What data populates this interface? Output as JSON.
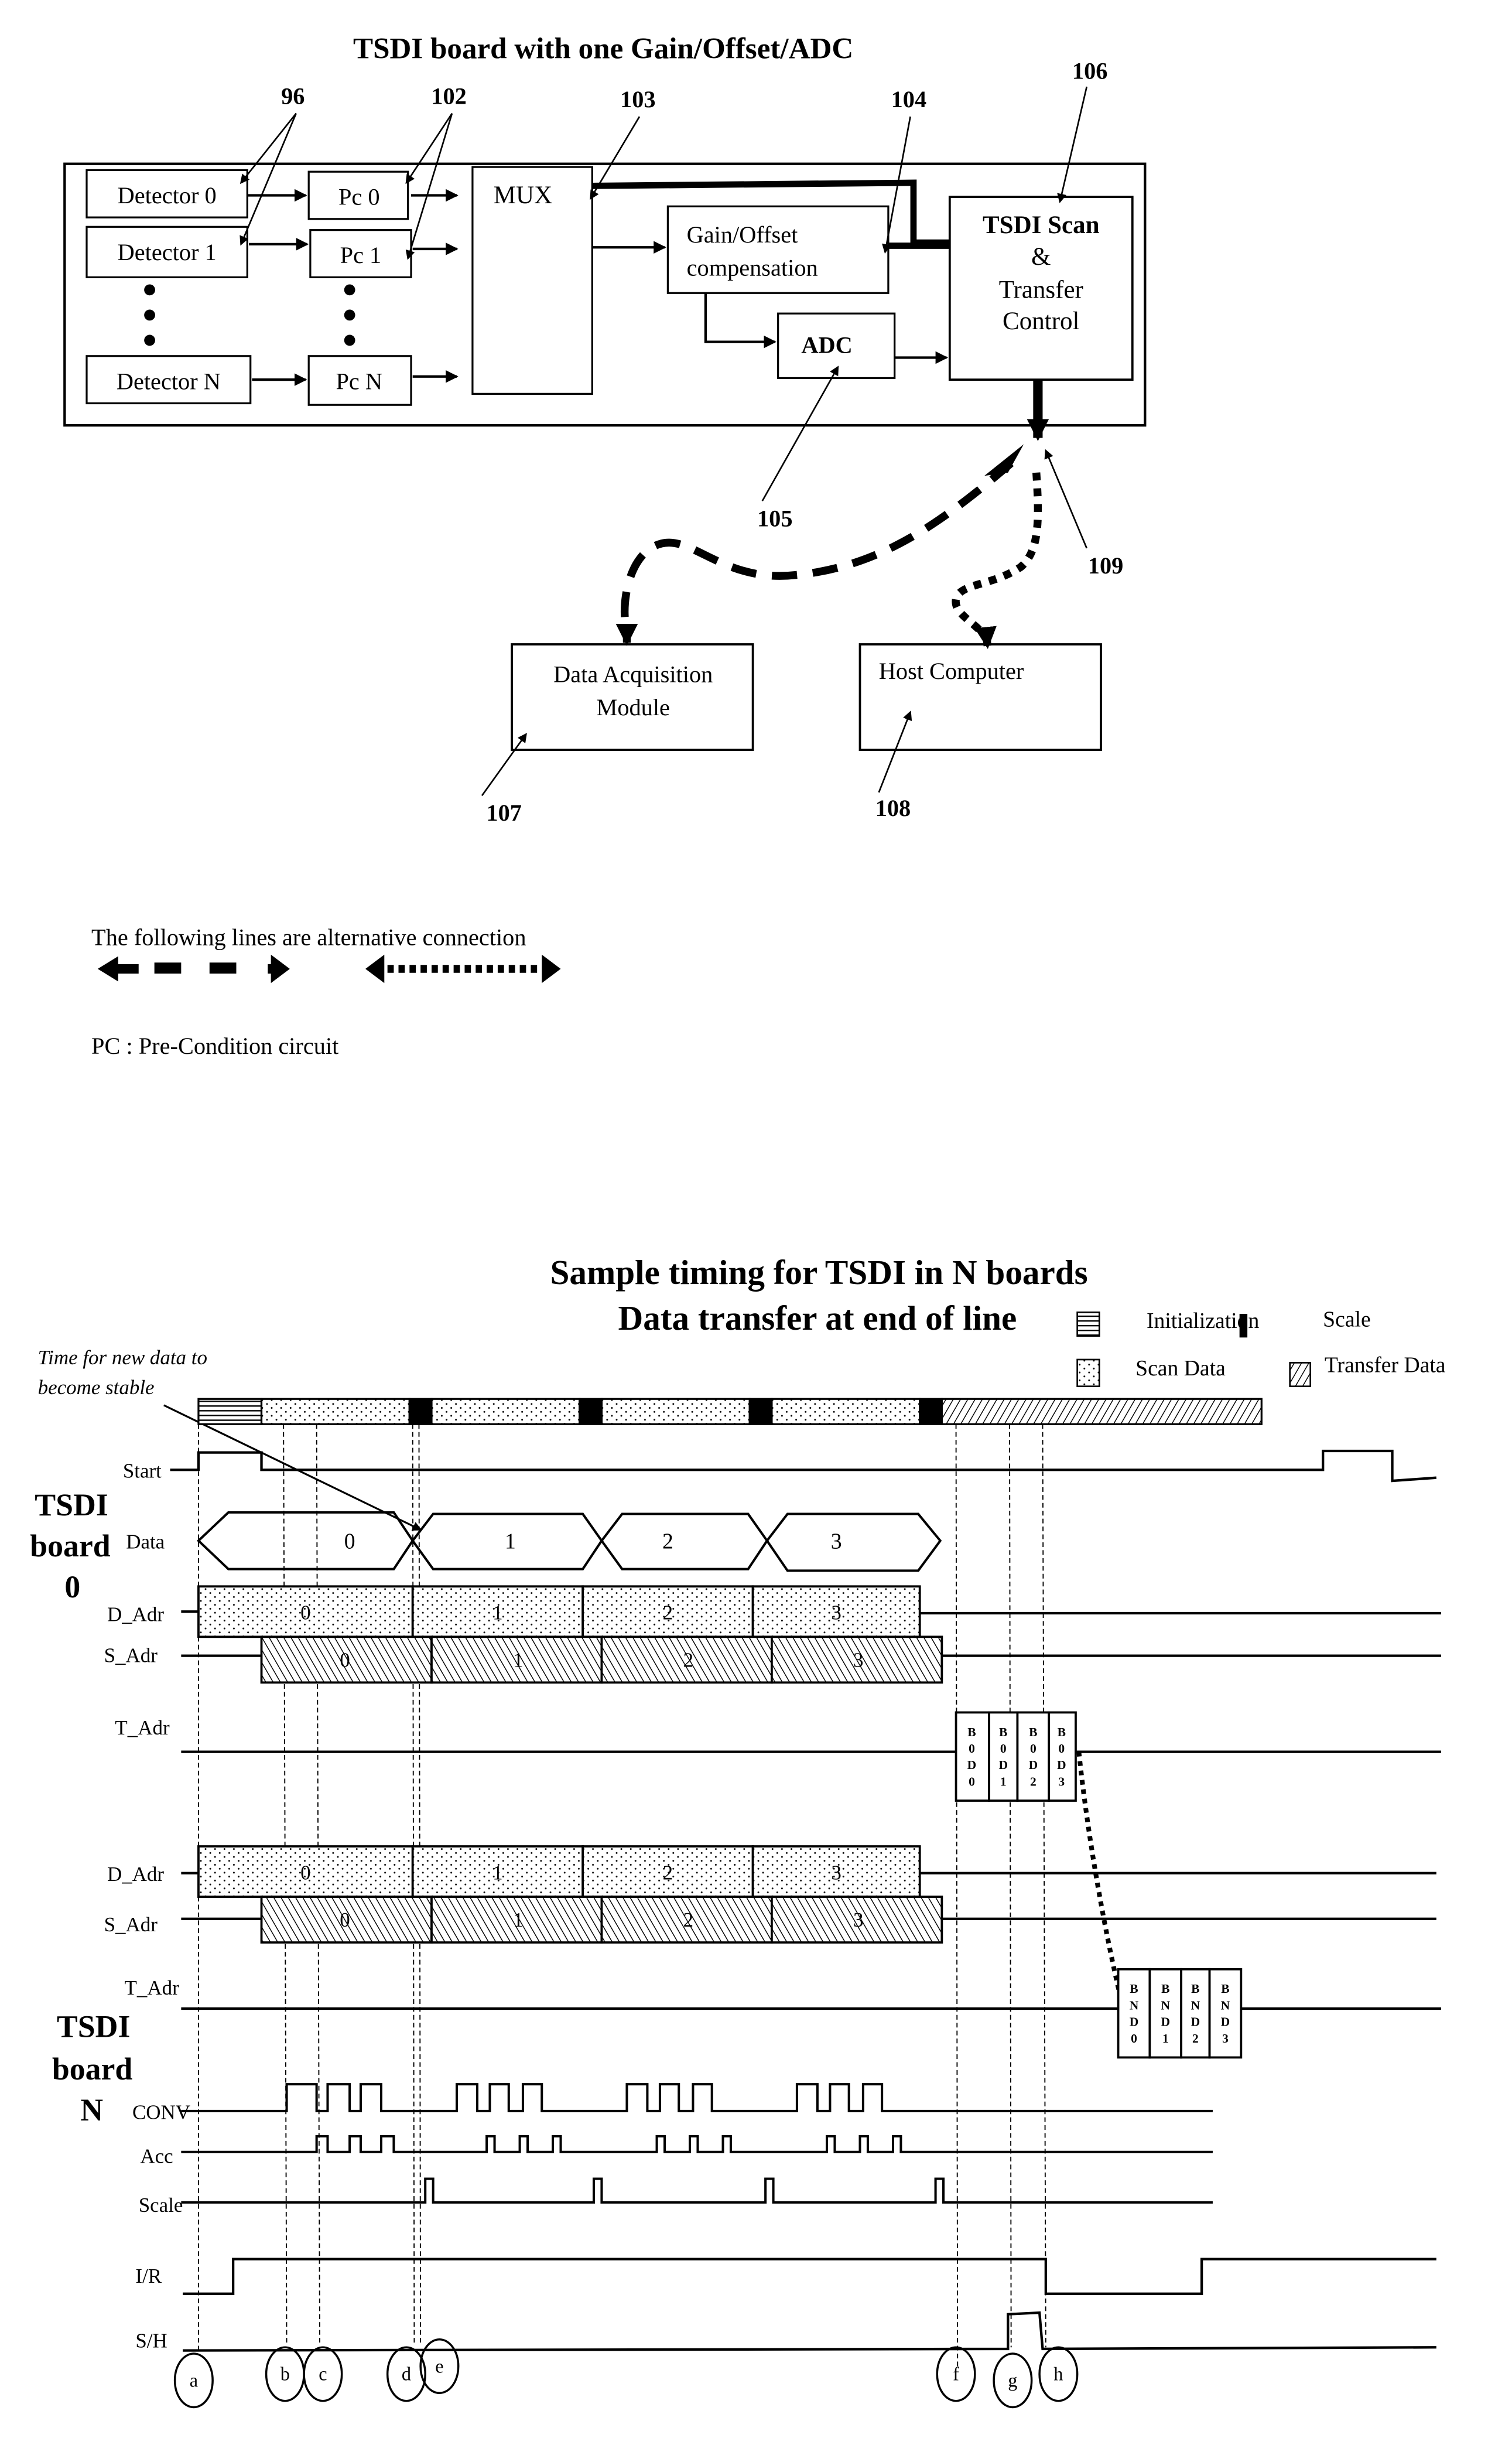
{
  "block_diagram": {
    "title": "TSDI board with one Gain/Offset/ADC",
    "detectors": [
      "Detector 0",
      "Detector 1",
      "Detector N"
    ],
    "preconditioners": [
      "Pc 0",
      "Pc 1",
      "Pc N"
    ],
    "mux": "MUX",
    "gain_offset": [
      "Gain/Offset",
      "compensation"
    ],
    "adc": "ADC",
    "tsdi_control": [
      "TSDI Scan",
      "&",
      "Transfer",
      "Control"
    ],
    "data_acquisition": [
      "Data Acquisition",
      "Module"
    ],
    "host_computer": "Host Computer",
    "refs": {
      "r96": "96",
      "r102": "102",
      "r103": "103",
      "r104": "104",
      "r105": "105",
      "r106": "106",
      "r107": "107",
      "r108": "108",
      "r109": "109"
    },
    "legend_text": "The following lines are alternative connection",
    "pc_note": "PC :  Pre-Condition circuit"
  },
  "timing": {
    "title_line1": "Sample timing for TSDI in N boards",
    "title_line2": "Data transfer at end of line",
    "legend": {
      "initialization": "Initialization",
      "scale": "Scale",
      "scan_data": "Scan Data",
      "transfer_data": "Transfer Data"
    },
    "annotation": [
      "Time for new data to",
      "become stable"
    ],
    "board0_label": [
      "TSDI",
      "board",
      "0"
    ],
    "boardN_label": [
      "TSDI",
      "board",
      "N"
    ],
    "signals": {
      "start": "Start",
      "data": "Data",
      "d_adr": "D_Adr",
      "s_adr": "S_Adr",
      "t_adr": "T_Adr",
      "conv": "CONV",
      "acc": "Acc",
      "scale": "Scale",
      "ir": "I/R",
      "sh": "S/H"
    },
    "data_values": [
      "0",
      "1",
      "2",
      "3"
    ],
    "board0_transfer": [
      [
        "B",
        "0",
        "D",
        "0"
      ],
      [
        "B",
        "0",
        "D",
        "1"
      ],
      [
        "B",
        "0",
        "D",
        "2"
      ],
      [
        "B",
        "0",
        "D",
        "3"
      ]
    ],
    "boardN_transfer": [
      [
        "B",
        "N",
        "D",
        "0"
      ],
      [
        "B",
        "N",
        "D",
        "1"
      ],
      [
        "B",
        "N",
        "D",
        "2"
      ],
      [
        "B",
        "N",
        "D",
        "3"
      ]
    ],
    "markers": [
      "a",
      "b",
      "c",
      "d",
      "e",
      "f",
      "g",
      "h"
    ]
  }
}
